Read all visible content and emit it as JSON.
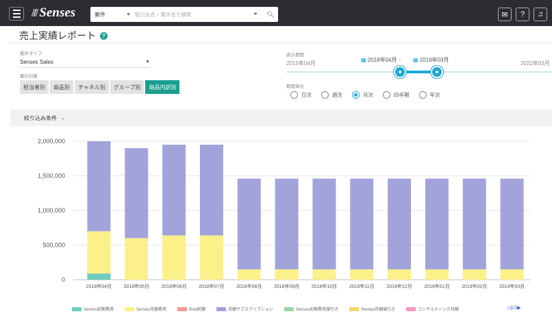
{
  "app": {
    "logo_text": "Senses"
  },
  "search": {
    "scope": "案件",
    "placeholder": "取引先名・案件名で検索"
  },
  "page": {
    "title": "売上実績レポート"
  },
  "controls": {
    "type_label": "案件タイプ",
    "type_value": "Senses Sales",
    "target_label": "集計対象",
    "group_buttons": [
      "担当者別",
      "商品別",
      "チャネル別",
      "グループ別",
      "商品内訳別"
    ],
    "active_group_index": 4,
    "period_label": "表示期間",
    "range_start": "2015年04月",
    "range_end": "2022年03月",
    "selected_from": "2018年04月",
    "selected_to": "2019年03月",
    "unit_label": "期間単位",
    "units": [
      "日次",
      "週次",
      "月次",
      "四半期",
      "年次"
    ],
    "selected_unit_index": 2,
    "filter_label": "絞り込み条件"
  },
  "colors": {
    "accent": "#1a9e8e",
    "slider": "#1aa7d9",
    "topbar": "#2b2d33"
  },
  "chart_data": {
    "type": "bar",
    "stacked": true,
    "categories": [
      "2018年04月",
      "2018年05月",
      "2018年06月",
      "2018年07月",
      "2018年08月",
      "2018年09月",
      "2018年10月",
      "2018年11月",
      "2018年12月",
      "2019年01月",
      "2019年02月",
      "2019年03月"
    ],
    "ylim": [
      0,
      2000000
    ],
    "yticks": [
      0,
      500000,
      1000000,
      1500000,
      2000000
    ],
    "ytick_labels": [
      "0",
      "500,000",
      "1,000,000",
      "1,500,000",
      "2,000,000"
    ],
    "grid": true,
    "series": [
      {
        "name": "Senses初期費用",
        "color": "#6fcdbd",
        "values": [
          90000,
          0,
          0,
          0,
          0,
          0,
          0,
          0,
          0,
          0,
          0,
          0
        ]
      },
      {
        "name": "Senses月額費用",
        "color": "#fbf08a",
        "values": [
          610000,
          600000,
          640000,
          640000,
          150000,
          150000,
          150000,
          150000,
          150000,
          150000,
          150000,
          150000
        ]
      },
      {
        "name": "iPad前額",
        "color": "#f49a9a",
        "values": [
          0,
          0,
          0,
          0,
          0,
          0,
          0,
          0,
          0,
          0,
          0,
          0
        ]
      },
      {
        "name": "月額サブスクリプション",
        "color": "#a3a3dc",
        "values": [
          1300000,
          1300000,
          1310000,
          1310000,
          1310000,
          1310000,
          1310000,
          1310000,
          1310000,
          1310000,
          1310000,
          1310000
        ]
      },
      {
        "name": "Senses初期費用値引き",
        "color": "#9ad7a7",
        "values": [
          0,
          0,
          0,
          0,
          0,
          0,
          0,
          0,
          0,
          0,
          0,
          0
        ]
      },
      {
        "name": "Senses月額値引き",
        "color": "#f6d66b",
        "values": [
          0,
          0,
          0,
          0,
          0,
          0,
          0,
          0,
          0,
          0,
          0,
          0
        ]
      },
      {
        "name": "コンサルティング月額",
        "color": "#f39ac1",
        "values": [
          0,
          0,
          0,
          0,
          0,
          0,
          0,
          0,
          0,
          0,
          0,
          0
        ]
      }
    ],
    "legend_position": "bottom",
    "legend_pager": "◁1/2▶"
  }
}
